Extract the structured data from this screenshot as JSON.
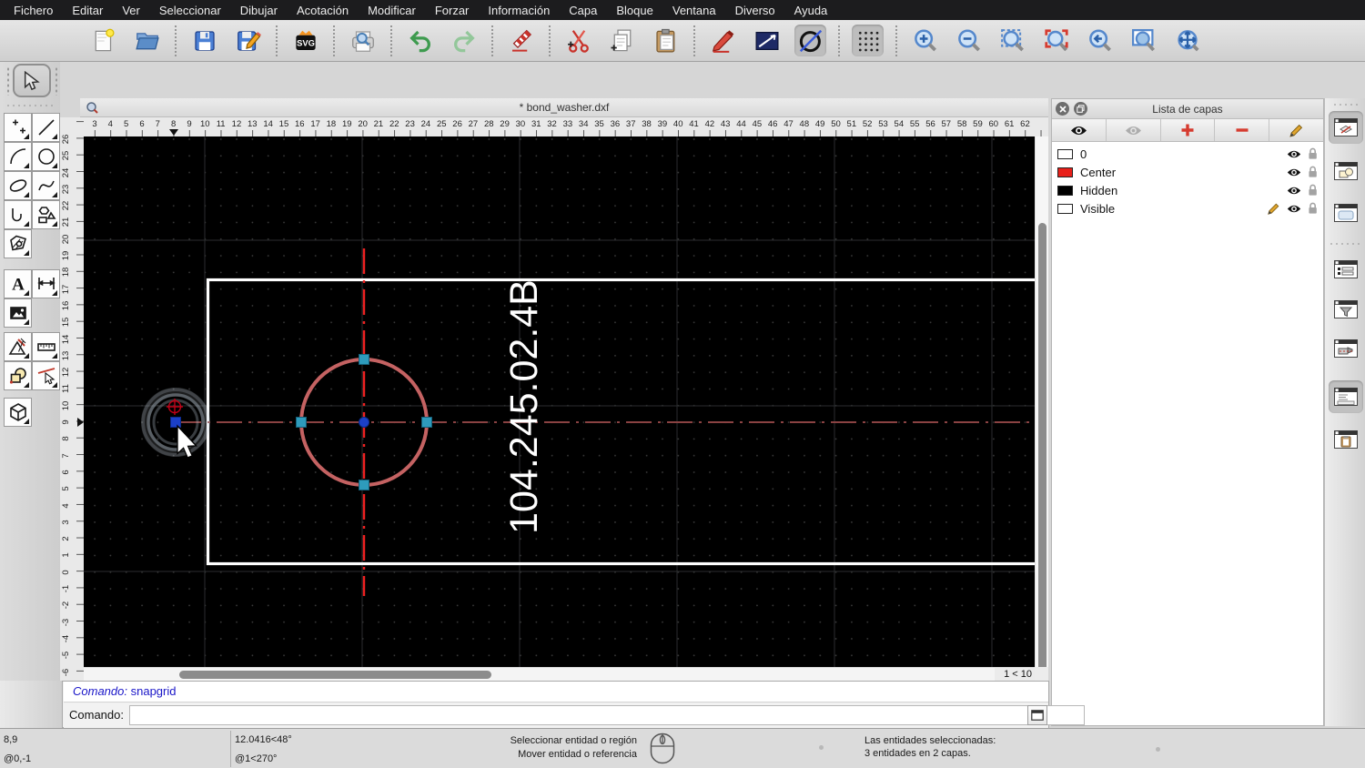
{
  "menu": {
    "items": [
      "Fichero",
      "Editar",
      "Ver",
      "Seleccionar",
      "Dibujar",
      "Acotación",
      "Modificar",
      "Forzar",
      "Información",
      "Capa",
      "Bloque",
      "Ventana",
      "Diverso",
      "Ayuda"
    ]
  },
  "toolbar": {
    "svg_badge": "SVG",
    "buttons": [
      "new-document",
      "open-file",
      "save",
      "save-as",
      "export-svg",
      "print-preview",
      "undo",
      "redo",
      "delete",
      "cut",
      "copy",
      "paste",
      "edit-attributes",
      "line-attributes",
      "toggle-construction",
      "snap-grid",
      "zoom-in",
      "zoom-out",
      "zoom-auto",
      "zoom-redraw",
      "zoom-previous",
      "zoom-window",
      "zoom-pan"
    ]
  },
  "palette": {
    "text_glyph": "A",
    "tools": [
      "select",
      "points",
      "line",
      "arc",
      "circle",
      "ellipse",
      "spline",
      "polyline",
      "polygon",
      "hatch",
      "text",
      "dimension",
      "image",
      "modify",
      "measure",
      "order",
      "delete-selected",
      "cube-3d"
    ]
  },
  "mdi": {
    "title": "* bond_washer.dxf",
    "zoom_indicator": "1 < 10"
  },
  "rulers": {
    "h_numbers": [
      3,
      4,
      5,
      6,
      7,
      8,
      9,
      10,
      11,
      12,
      13,
      14,
      15,
      16,
      17,
      18,
      19,
      20,
      21,
      22,
      23,
      24,
      25,
      26,
      27,
      28,
      29,
      30,
      31,
      32,
      33,
      34,
      35,
      36,
      37,
      38,
      39,
      40,
      41,
      42,
      43,
      44,
      45,
      46,
      47,
      48,
      49,
      50,
      51,
      52,
      53,
      54,
      55,
      56,
      57,
      58,
      59,
      60,
      61,
      62
    ],
    "v_numbers": [
      26,
      25,
      24,
      23,
      22,
      21,
      20,
      19,
      18,
      17,
      16,
      15,
      14,
      13,
      12,
      11,
      10,
      9,
      8,
      7,
      6,
      5,
      4,
      3,
      2,
      1,
      0,
      -1,
      -2,
      -3,
      -4,
      -5,
      -6
    ],
    "h_marker": 8,
    "v_marker": 9
  },
  "canvas": {
    "part_label": "104.245.02.4B",
    "colors": {
      "background": "#000000",
      "entity": "#FFFFFF",
      "selected_entity": "#C46262",
      "handle": "#2E9BBC",
      "reference_point": "#1B40C8",
      "centerline_active": "#EE2020",
      "centerline": "#8A4242",
      "snap_indicator": "#B8C8D4",
      "crosshair_mark": "#C00016"
    }
  },
  "layer_panel": {
    "title": "Lista de capas",
    "toolbar_buttons": [
      "show-all-layers",
      "hide-all-layers",
      "add-layer",
      "remove-layer",
      "edit-layer"
    ],
    "layers": [
      {
        "name": "0",
        "color": "#FFFFFF",
        "editing": false
      },
      {
        "name": "Center",
        "color": "#E8201A",
        "editing": false
      },
      {
        "name": "Hidden",
        "color": "#000000",
        "editing": false
      },
      {
        "name": "Visible",
        "color": "#FFFFFF",
        "editing": true
      }
    ]
  },
  "dock_right": {
    "buttons": [
      "layers-dock",
      "blocks-dock",
      "library-dock",
      "entity-list-dock",
      "filter-dock",
      "measurement-dock",
      "command-dock",
      "clipboard-dock"
    ],
    "pressed": [
      0,
      6
    ]
  },
  "command": {
    "history_label": "Comando:",
    "history_value": "snapgrid",
    "prompt_label": "Comando:",
    "input_value": ""
  },
  "status_bar": {
    "abs_coord": "8,9",
    "rel_coord": "@0,-1",
    "polar_coord": "12.0416<48°",
    "rel_polar_coord": "@1<270°",
    "hint_line1": "Seleccionar entidad o región",
    "hint_line2": "Mover entidad o referencia",
    "selection_line1": "Las entidades seleccionadas:",
    "selection_line2": "3 entidades en 2 capas."
  }
}
